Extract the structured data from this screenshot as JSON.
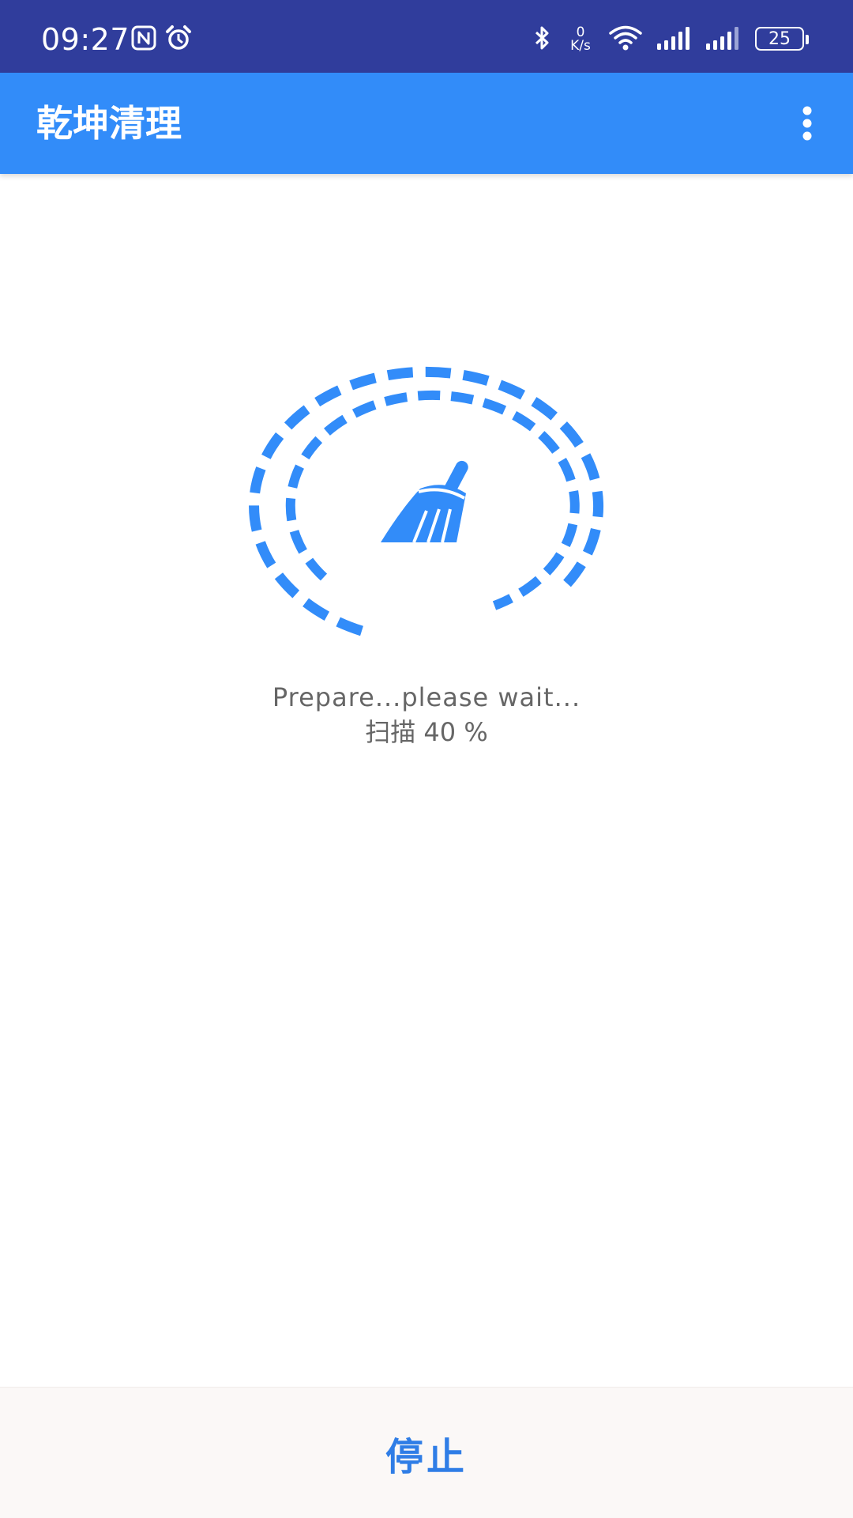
{
  "status_bar": {
    "time": "09:27",
    "net_speed_value": "0",
    "net_speed_unit": "K/s",
    "battery_level": "25",
    "icons": [
      "nfc-icon",
      "alarm-icon",
      "bluetooth-icon",
      "wifi-icon",
      "signal-icon",
      "signal-icon"
    ]
  },
  "app_bar": {
    "title": "乾坤清理",
    "menu_icon": "more-vert-icon"
  },
  "scanner": {
    "icon": "broom-icon",
    "message": "Prepare...please wait...",
    "progress_label": "扫描 40 %",
    "progress_percent": 40
  },
  "bottom": {
    "stop_label": "停止"
  },
  "colors": {
    "status_bar": "#303d9c",
    "app_bar": "#328cf9",
    "accent": "#328cf9",
    "stop_text": "#2f7de6",
    "message_text": "#666666",
    "bottom_bar": "#fbf8f7"
  }
}
